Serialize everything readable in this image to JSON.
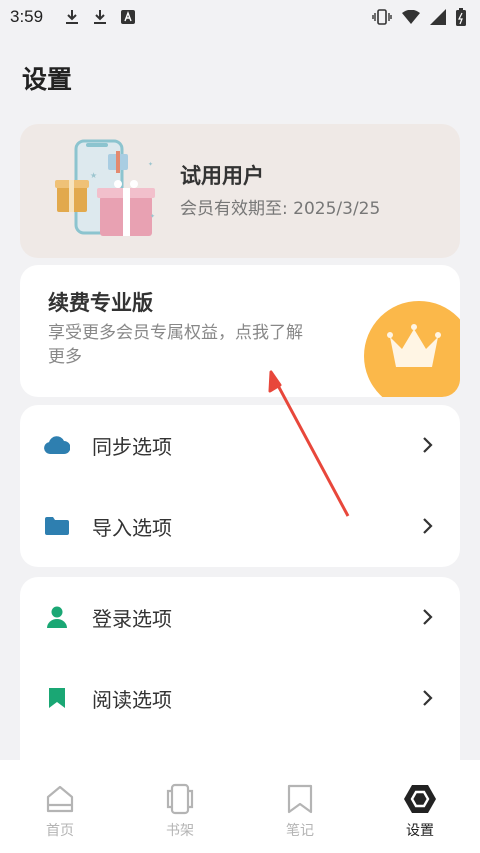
{
  "status_bar": {
    "time": "3:59"
  },
  "page": {
    "title": "设置"
  },
  "trial": {
    "name": "试用用户",
    "expiry": "会员有效期至: 2025/3/25"
  },
  "pro": {
    "title": "续费专业版",
    "description": "享受更多会员专属权益，点我了解更多"
  },
  "menu_group_1": [
    {
      "label": "同步选项",
      "icon": "cloud-icon"
    },
    {
      "label": "导入选项",
      "icon": "folder-icon"
    }
  ],
  "menu_group_2": [
    {
      "label": "登录选项",
      "icon": "user-icon"
    },
    {
      "label": "阅读选项",
      "icon": "bookmark-icon"
    }
  ],
  "bottom_nav": [
    {
      "label": "首页",
      "icon": "home-icon"
    },
    {
      "label": "书架",
      "icon": "bookshelf-icon"
    },
    {
      "label": "笔记",
      "icon": "notes-icon"
    },
    {
      "label": "设置",
      "icon": "settings-icon",
      "active": true
    }
  ],
  "colors": {
    "accent_blue": "#2e7fb0",
    "accent_green": "#1aa774",
    "crown_orange": "#fbb84a",
    "annotation_red": "#e8473b"
  }
}
